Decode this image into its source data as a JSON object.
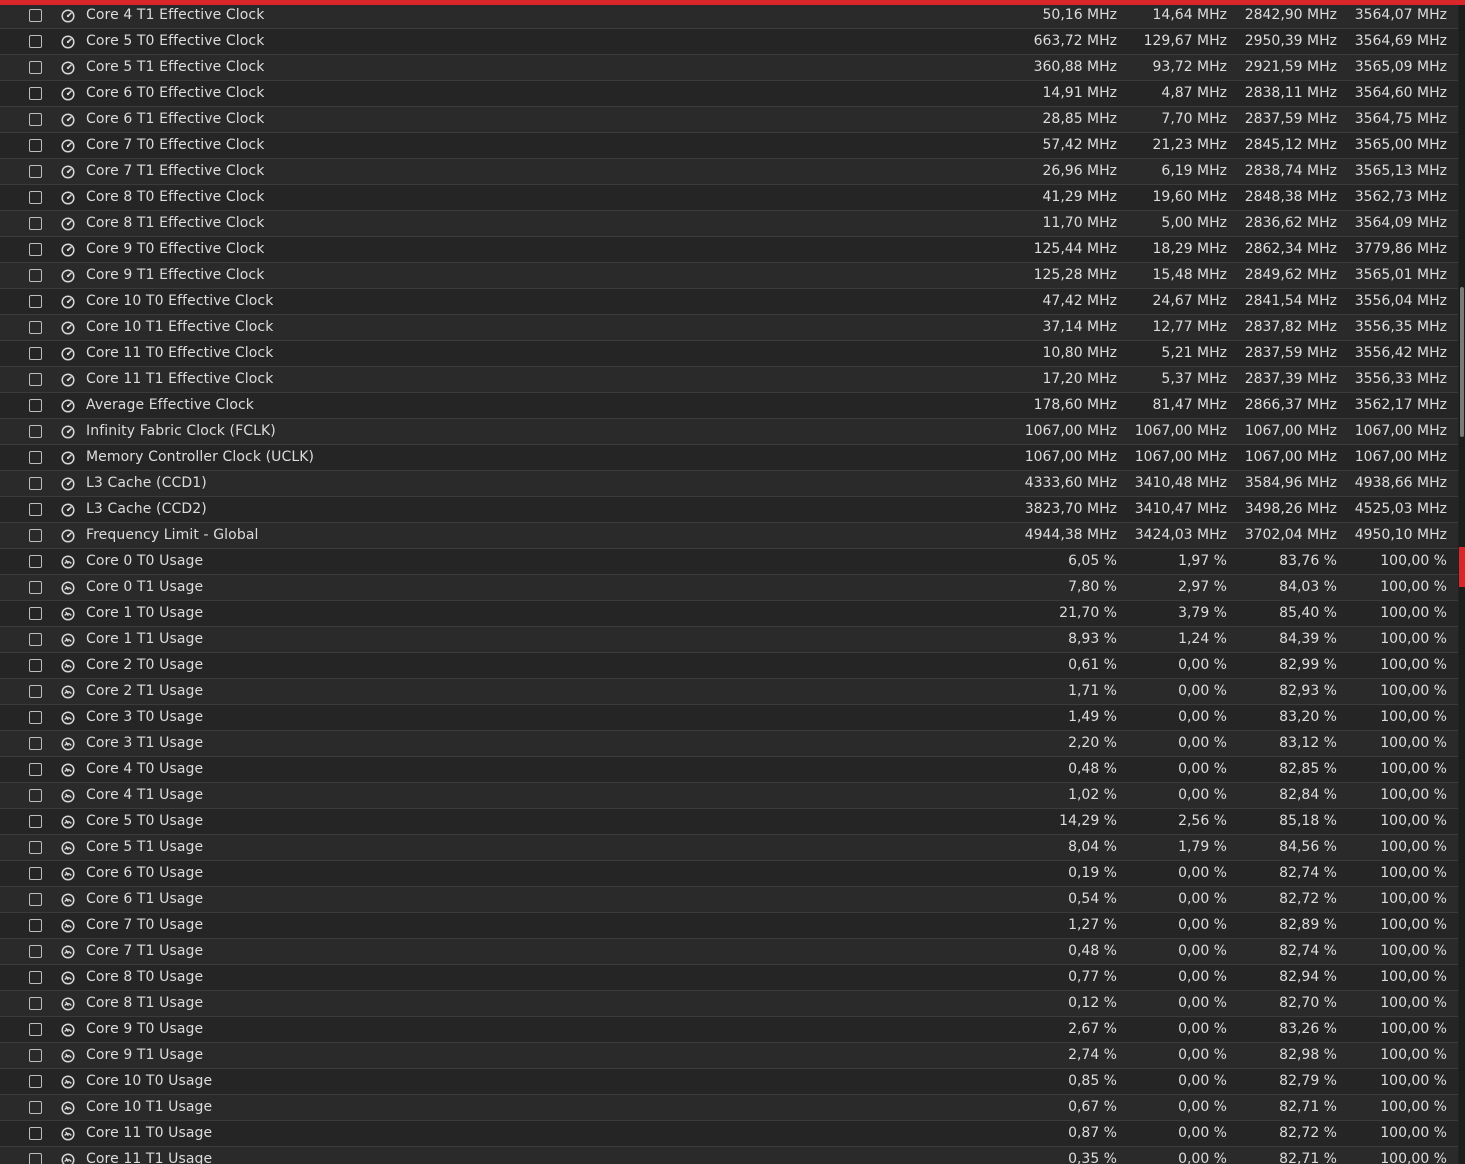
{
  "accent_color": "#d9262b",
  "icons": {
    "clock": "gauge-icon",
    "usage": "usage-meter-icon"
  },
  "rows": [
    {
      "label": "Core 4 T1 Effective Clock",
      "icon": "clock",
      "current": "50,16 MHz",
      "min": "14,64 MHz",
      "max": "2842,90 MHz",
      "avg": "3564,07 MHz"
    },
    {
      "label": "Core 5 T0 Effective Clock",
      "icon": "clock",
      "current": "663,72 MHz",
      "min": "129,67 MHz",
      "max": "2950,39 MHz",
      "avg": "3564,69 MHz"
    },
    {
      "label": "Core 5 T1 Effective Clock",
      "icon": "clock",
      "current": "360,88 MHz",
      "min": "93,72 MHz",
      "max": "2921,59 MHz",
      "avg": "3565,09 MHz"
    },
    {
      "label": "Core 6 T0 Effective Clock",
      "icon": "clock",
      "current": "14,91 MHz",
      "min": "4,87 MHz",
      "max": "2838,11 MHz",
      "avg": "3564,60 MHz"
    },
    {
      "label": "Core 6 T1 Effective Clock",
      "icon": "clock",
      "current": "28,85 MHz",
      "min": "7,70 MHz",
      "max": "2837,59 MHz",
      "avg": "3564,75 MHz"
    },
    {
      "label": "Core 7 T0 Effective Clock",
      "icon": "clock",
      "current": "57,42 MHz",
      "min": "21,23 MHz",
      "max": "2845,12 MHz",
      "avg": "3565,00 MHz"
    },
    {
      "label": "Core 7 T1 Effective Clock",
      "icon": "clock",
      "current": "26,96 MHz",
      "min": "6,19 MHz",
      "max": "2838,74 MHz",
      "avg": "3565,13 MHz"
    },
    {
      "label": "Core 8 T0 Effective Clock",
      "icon": "clock",
      "current": "41,29 MHz",
      "min": "19,60 MHz",
      "max": "2848,38 MHz",
      "avg": "3562,73 MHz"
    },
    {
      "label": "Core 8 T1 Effective Clock",
      "icon": "clock",
      "current": "11,70 MHz",
      "min": "5,00 MHz",
      "max": "2836,62 MHz",
      "avg": "3564,09 MHz"
    },
    {
      "label": "Core 9 T0 Effective Clock",
      "icon": "clock",
      "current": "125,44 MHz",
      "min": "18,29 MHz",
      "max": "2862,34 MHz",
      "avg": "3779,86 MHz"
    },
    {
      "label": "Core 9 T1 Effective Clock",
      "icon": "clock",
      "current": "125,28 MHz",
      "min": "15,48 MHz",
      "max": "2849,62 MHz",
      "avg": "3565,01 MHz"
    },
    {
      "label": "Core 10 T0 Effective Clock",
      "icon": "clock",
      "current": "47,42 MHz",
      "min": "24,67 MHz",
      "max": "2841,54 MHz",
      "avg": "3556,04 MHz"
    },
    {
      "label": "Core 10 T1 Effective Clock",
      "icon": "clock",
      "current": "37,14 MHz",
      "min": "12,77 MHz",
      "max": "2837,82 MHz",
      "avg": "3556,35 MHz"
    },
    {
      "label": "Core 11 T0 Effective Clock",
      "icon": "clock",
      "current": "10,80 MHz",
      "min": "5,21 MHz",
      "max": "2837,59 MHz",
      "avg": "3556,42 MHz"
    },
    {
      "label": "Core 11 T1 Effective Clock",
      "icon": "clock",
      "current": "17,20 MHz",
      "min": "5,37 MHz",
      "max": "2837,39 MHz",
      "avg": "3556,33 MHz"
    },
    {
      "label": "Average Effective Clock",
      "icon": "clock",
      "current": "178,60 MHz",
      "min": "81,47 MHz",
      "max": "2866,37 MHz",
      "avg": "3562,17 MHz"
    },
    {
      "label": "Infinity Fabric Clock (FCLK)",
      "icon": "clock",
      "current": "1067,00 MHz",
      "min": "1067,00 MHz",
      "max": "1067,00 MHz",
      "avg": "1067,00 MHz"
    },
    {
      "label": "Memory Controller Clock (UCLK)",
      "icon": "clock",
      "current": "1067,00 MHz",
      "min": "1067,00 MHz",
      "max": "1067,00 MHz",
      "avg": "1067,00 MHz"
    },
    {
      "label": "L3 Cache (CCD1)",
      "icon": "clock",
      "current": "4333,60 MHz",
      "min": "3410,48 MHz",
      "max": "3584,96 MHz",
      "avg": "4938,66 MHz"
    },
    {
      "label": "L3 Cache (CCD2)",
      "icon": "clock",
      "current": "3823,70 MHz",
      "min": "3410,47 MHz",
      "max": "3498,26 MHz",
      "avg": "4525,03 MHz"
    },
    {
      "label": "Frequency Limit - Global",
      "icon": "clock",
      "current": "4944,38 MHz",
      "min": "3424,03 MHz",
      "max": "3702,04 MHz",
      "avg": "4950,10 MHz"
    },
    {
      "label": "Core 0 T0 Usage",
      "icon": "usage",
      "current": "6,05 %",
      "min": "1,97 %",
      "max": "83,76 %",
      "avg": "100,00 %"
    },
    {
      "label": "Core 0 T1 Usage",
      "icon": "usage",
      "current": "7,80 %",
      "min": "2,97 %",
      "max": "84,03 %",
      "avg": "100,00 %"
    },
    {
      "label": "Core 1 T0 Usage",
      "icon": "usage",
      "current": "21,70 %",
      "min": "3,79 %",
      "max": "85,40 %",
      "avg": "100,00 %"
    },
    {
      "label": "Core 1 T1 Usage",
      "icon": "usage",
      "current": "8,93 %",
      "min": "1,24 %",
      "max": "84,39 %",
      "avg": "100,00 %"
    },
    {
      "label": "Core 2 T0 Usage",
      "icon": "usage",
      "current": "0,61 %",
      "min": "0,00 %",
      "max": "82,99 %",
      "avg": "100,00 %"
    },
    {
      "label": "Core 2 T1 Usage",
      "icon": "usage",
      "current": "1,71 %",
      "min": "0,00 %",
      "max": "82,93 %",
      "avg": "100,00 %"
    },
    {
      "label": "Core 3 T0 Usage",
      "icon": "usage",
      "current": "1,49 %",
      "min": "0,00 %",
      "max": "83,20 %",
      "avg": "100,00 %"
    },
    {
      "label": "Core 3 T1 Usage",
      "icon": "usage",
      "current": "2,20 %",
      "min": "0,00 %",
      "max": "83,12 %",
      "avg": "100,00 %"
    },
    {
      "label": "Core 4 T0 Usage",
      "icon": "usage",
      "current": "0,48 %",
      "min": "0,00 %",
      "max": "82,85 %",
      "avg": "100,00 %"
    },
    {
      "label": "Core 4 T1 Usage",
      "icon": "usage",
      "current": "1,02 %",
      "min": "0,00 %",
      "max": "82,84 %",
      "avg": "100,00 %"
    },
    {
      "label": "Core 5 T0 Usage",
      "icon": "usage",
      "current": "14,29 %",
      "min": "2,56 %",
      "max": "85,18 %",
      "avg": "100,00 %"
    },
    {
      "label": "Core 5 T1 Usage",
      "icon": "usage",
      "current": "8,04 %",
      "min": "1,79 %",
      "max": "84,56 %",
      "avg": "100,00 %"
    },
    {
      "label": "Core 6 T0 Usage",
      "icon": "usage",
      "current": "0,19 %",
      "min": "0,00 %",
      "max": "82,74 %",
      "avg": "100,00 %"
    },
    {
      "label": "Core 6 T1 Usage",
      "icon": "usage",
      "current": "0,54 %",
      "min": "0,00 %",
      "max": "82,72 %",
      "avg": "100,00 %"
    },
    {
      "label": "Core 7 T0 Usage",
      "icon": "usage",
      "current": "1,27 %",
      "min": "0,00 %",
      "max": "82,89 %",
      "avg": "100,00 %"
    },
    {
      "label": "Core 7 T1 Usage",
      "icon": "usage",
      "current": "0,48 %",
      "min": "0,00 %",
      "max": "82,74 %",
      "avg": "100,00 %"
    },
    {
      "label": "Core 8 T0 Usage",
      "icon": "usage",
      "current": "0,77 %",
      "min": "0,00 %",
      "max": "82,94 %",
      "avg": "100,00 %"
    },
    {
      "label": "Core 8 T1 Usage",
      "icon": "usage",
      "current": "0,12 %",
      "min": "0,00 %",
      "max": "82,70 %",
      "avg": "100,00 %"
    },
    {
      "label": "Core 9 T0 Usage",
      "icon": "usage",
      "current": "2,67 %",
      "min": "0,00 %",
      "max": "83,26 %",
      "avg": "100,00 %"
    },
    {
      "label": "Core 9 T1 Usage",
      "icon": "usage",
      "current": "2,74 %",
      "min": "0,00 %",
      "max": "82,98 %",
      "avg": "100,00 %"
    },
    {
      "label": "Core 10 T0 Usage",
      "icon": "usage",
      "current": "0,85 %",
      "min": "0,00 %",
      "max": "82,79 %",
      "avg": "100,00 %"
    },
    {
      "label": "Core 10 T1 Usage",
      "icon": "usage",
      "current": "0,67 %",
      "min": "0,00 %",
      "max": "82,71 %",
      "avg": "100,00 %"
    },
    {
      "label": "Core 11 T0 Usage",
      "icon": "usage",
      "current": "0,87 %",
      "min": "0,00 %",
      "max": "82,72 %",
      "avg": "100,00 %"
    },
    {
      "label": "Core 11 T1 Usage",
      "icon": "usage",
      "current": "0,35 %",
      "min": "0,00 %",
      "max": "82,71 %",
      "avg": "100,00 %"
    }
  ]
}
